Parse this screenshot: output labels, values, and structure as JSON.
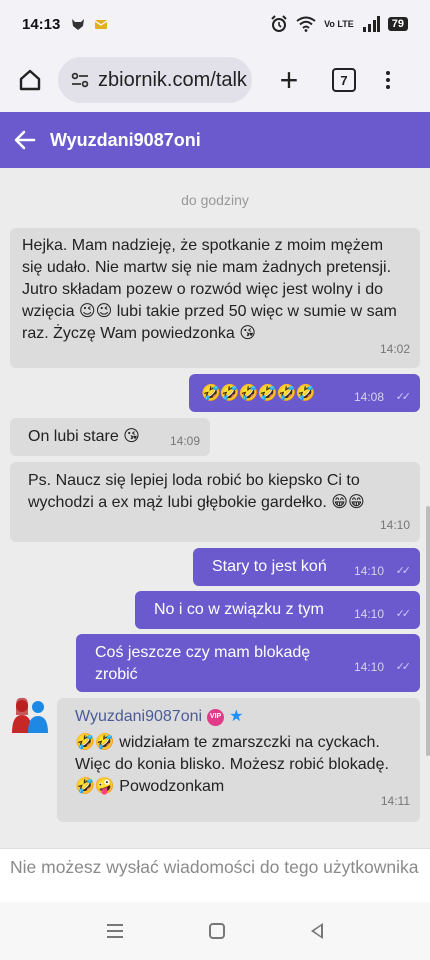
{
  "status_bar": {
    "time": "14:13",
    "network": "Vo LTE",
    "battery": "79"
  },
  "browser": {
    "url": "zbiornik.com/talk",
    "tab_count": "7",
    "new_tab": "+"
  },
  "app_bar": {
    "title": "Wyuzdani9087oni"
  },
  "chat": {
    "divider": "do godziny",
    "messages": [
      {
        "direction": "in",
        "text": "Hejka. Mam nadzieję, że spotkanie z moim mężem się udało. Nie martw się nie mam żadnych pretensji. Jutro składam pozew o rozwód więc jest wolny i do wzięcia 😉😉 lubi takie przed 50 więc w sumie w sam raz. Życzę Wam powiedzonka 😘",
        "time": "14:02"
      },
      {
        "direction": "out",
        "text": "🤣🤣🤣🤣🤣🤣",
        "time": "14:08"
      },
      {
        "direction": "in",
        "text": "On lubi stare 😘",
        "time": "14:09"
      },
      {
        "direction": "in",
        "text": "Ps. Naucz się lepiej loda robić bo kiepsko Ci to wychodzi a ex mąż lubi głębokie gardełko. 😁😁",
        "time": "14:10"
      },
      {
        "direction": "out",
        "text": "Stary to jest koń",
        "time": "14:10"
      },
      {
        "direction": "out",
        "text": "No i co w związku z tym",
        "time": "14:10"
      },
      {
        "direction": "out",
        "text": "Coś jeszcze czy mam blokadę zrobić",
        "time": "14:10"
      },
      {
        "direction": "in",
        "sender": "Wyuzdani9087oni",
        "badge": "VIP",
        "text": "🤣🤣 widziałam te zmarszczki na cyckach. Więc do konia blisko. Możesz robić blokadę. 🤣🤪 Powodzonkam",
        "time": "14:11"
      }
    ]
  },
  "footer": {
    "notice": "Nie możesz wysłać wiadomości do tego użytkownika"
  },
  "colors": {
    "accent": "#6a5acd",
    "incoming_bubble": "#dcdcdc",
    "chat_bg": "#ececec"
  }
}
